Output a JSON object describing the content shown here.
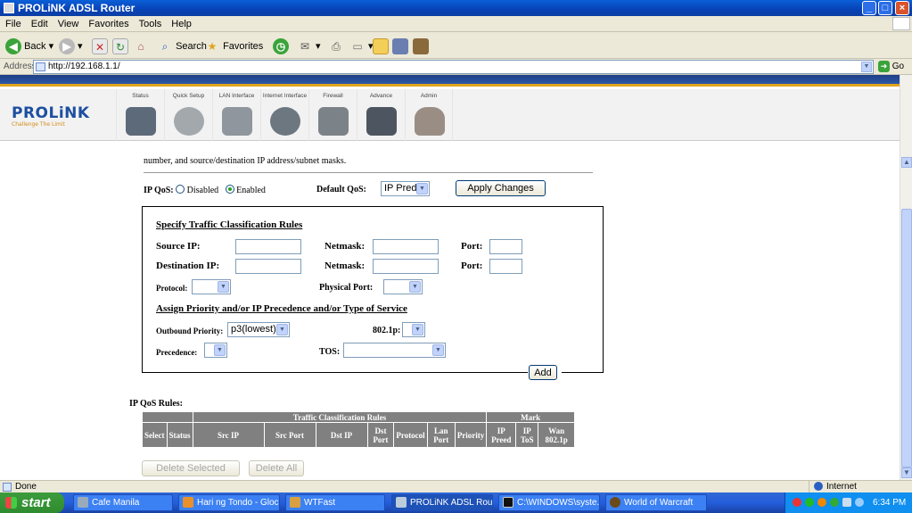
{
  "window": {
    "title": "PROLiNK ADSL Router"
  },
  "menu": [
    "File",
    "Edit",
    "View",
    "Favorites",
    "Tools",
    "Help"
  ],
  "toolbar": {
    "back": "Back",
    "search": "Search",
    "favorites": "Favorites"
  },
  "address": {
    "label": "Address",
    "url": "http://192.168.1.1/",
    "go": "Go"
  },
  "router": {
    "logo": "PROLiNK",
    "tagline": "Challenge The Limit",
    "nav": [
      {
        "label": "Status"
      },
      {
        "label": "Quick Setup"
      },
      {
        "label": "LAN Interface"
      },
      {
        "label": "Internet Interface"
      },
      {
        "label": "Firewall"
      },
      {
        "label": "Advance"
      },
      {
        "label": "Admin"
      }
    ]
  },
  "page": {
    "intro": "number, and source/destination IP address/subnet masks.",
    "ipqos_label": "IP QoS:",
    "disabled_label": "Disabled",
    "enabled_label": "Enabled",
    "default_qos_label": "Default QoS:",
    "default_qos_value": "IP Pred",
    "apply_button": "Apply Changes",
    "specify_title": "Specify Traffic Classification Rules",
    "source_ip_label": "Source IP:",
    "netmask_label": "Netmask:",
    "port_label": "Port:",
    "dest_ip_label": "Destination IP:",
    "protocol_label": "Protocol:",
    "physical_port_label": "Physical Port:",
    "assign_title": "Assign Priority and/or IP Precedence and/or Type of Service",
    "outbound_label": "Outbound Priority:",
    "outbound_value": "p3(lowest)",
    "dot1p_label": "802.1p:",
    "precedence_label": "Precedence:",
    "tos_label": "TOS:",
    "add_button": "Add",
    "rules_title": "IP QoS Rules:",
    "table": {
      "group_traffic": "Traffic Classification Rules",
      "group_mark": "Mark",
      "columns": [
        "Select",
        "Status",
        "Src IP",
        "Src Port",
        "Dst IP",
        "Dst Port",
        "Protocol",
        "Lan Port",
        "Priority",
        "IP Preed",
        "IP ToS",
        "Wan 802.1p"
      ]
    },
    "delete_selected": "Delete Selected",
    "delete_all": "Delete All"
  },
  "status": {
    "left": "Done",
    "zone": "Internet"
  },
  "taskbar": {
    "start": "start",
    "tasks": [
      "Cafe Manila",
      "Hari ng Tondo - Gloc ...",
      "WTFast",
      "PROLiNK ADSL Router",
      "C:\\WINDOWS\\syste...",
      "World of Warcraft"
    ],
    "clock": "6:34 PM"
  }
}
